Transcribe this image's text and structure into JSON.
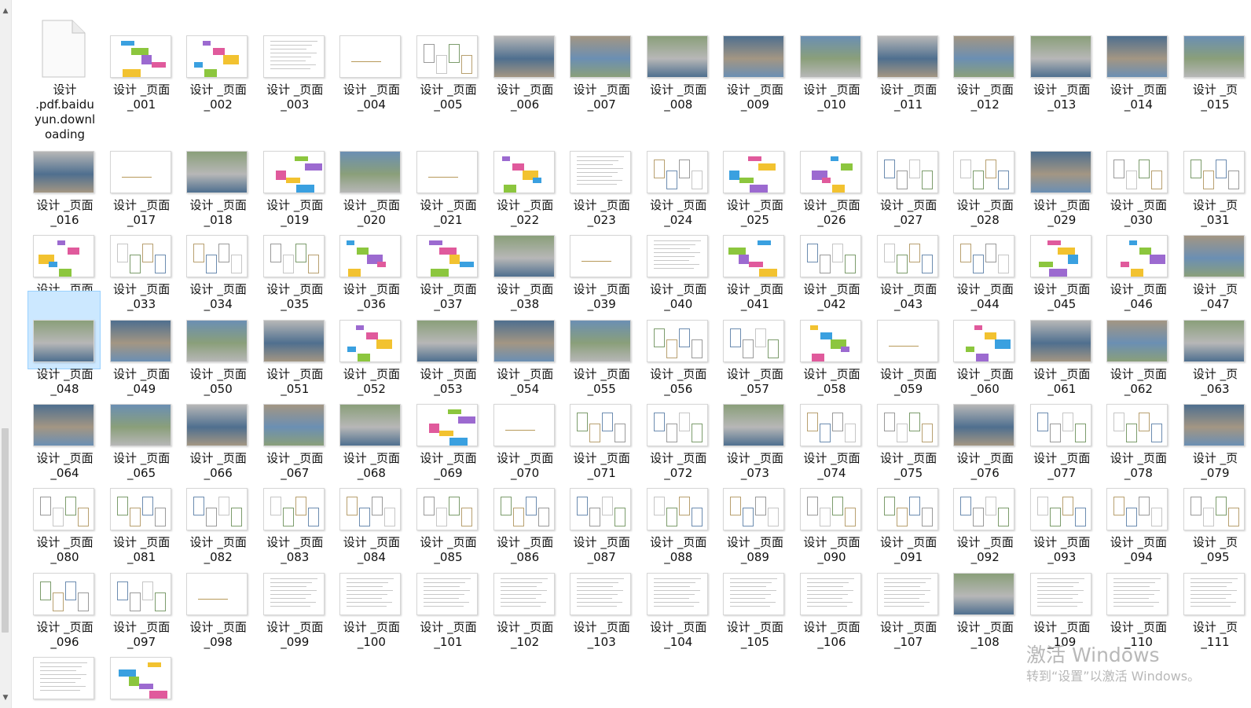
{
  "colors": {
    "selection_bg": "#cce8ff",
    "selection_border": "#99d1ff",
    "watermark": "#b8b8b8"
  },
  "files": [
    {
      "name": "设计\n.pdf.baidu\nyun.downl\noading",
      "icon": "blank-file-icon",
      "kind": "download"
    },
    {
      "name": "设计 _页面\n_001",
      "icon": "page-thumbnail",
      "kind": "color"
    },
    {
      "name": "设计 _页面\n_002",
      "icon": "page-thumbnail",
      "kind": "color"
    },
    {
      "name": "设计 _页面\n_003",
      "icon": "page-thumbnail",
      "kind": "text"
    },
    {
      "name": "设计 _页面\n_004",
      "icon": "page-thumbnail",
      "kind": "blank"
    },
    {
      "name": "设计 _页面\n_005",
      "icon": "page-thumbnail",
      "kind": "plan"
    },
    {
      "name": "设计 _页面\n_006",
      "icon": "page-thumbnail",
      "kind": "photo"
    },
    {
      "name": "设计 _页面\n_007",
      "icon": "page-thumbnail",
      "kind": "photo"
    },
    {
      "name": "设计 _页面\n_008",
      "icon": "page-thumbnail",
      "kind": "photo"
    },
    {
      "name": "设计 _页面\n_009",
      "icon": "page-thumbnail",
      "kind": "photo"
    },
    {
      "name": "设计 _页面\n_010",
      "icon": "page-thumbnail",
      "kind": "photo"
    },
    {
      "name": "设计 _页面\n_011",
      "icon": "page-thumbnail",
      "kind": "photo"
    },
    {
      "name": "设计 _页面\n_012",
      "icon": "page-thumbnail",
      "kind": "photo"
    },
    {
      "name": "设计 _页面\n_013",
      "icon": "page-thumbnail",
      "kind": "photo"
    },
    {
      "name": "设计 _页面\n_014",
      "icon": "page-thumbnail",
      "kind": "photo"
    },
    {
      "name": "设计 _页\n_015",
      "icon": "page-thumbnail",
      "kind": "photo"
    },
    {
      "name": "设计 _页面\n_016",
      "icon": "page-thumbnail",
      "kind": "photo"
    },
    {
      "name": "设计 _页面\n_017",
      "icon": "page-thumbnail",
      "kind": "blank"
    },
    {
      "name": "设计 _页面\n_018",
      "icon": "page-thumbnail",
      "kind": "photo"
    },
    {
      "name": "设计 _页面\n_019",
      "icon": "page-thumbnail",
      "kind": "color"
    },
    {
      "name": "设计 _页面\n_020",
      "icon": "page-thumbnail",
      "kind": "photo"
    },
    {
      "name": "设计 _页面\n_021",
      "icon": "page-thumbnail",
      "kind": "blank"
    },
    {
      "name": "设计 _页面\n_022",
      "icon": "page-thumbnail",
      "kind": "color"
    },
    {
      "name": "设计 _页面\n_023",
      "icon": "page-thumbnail",
      "kind": "text"
    },
    {
      "name": "设计 _页面\n_024",
      "icon": "page-thumbnail",
      "kind": "plan"
    },
    {
      "name": "设计 _页面\n_025",
      "icon": "page-thumbnail",
      "kind": "color"
    },
    {
      "name": "设计 _页面\n_026",
      "icon": "page-thumbnail",
      "kind": "color"
    },
    {
      "name": "设计 _页面\n_027",
      "icon": "page-thumbnail",
      "kind": "plan"
    },
    {
      "name": "设计 _页面\n_028",
      "icon": "page-thumbnail",
      "kind": "plan"
    },
    {
      "name": "设计 _页面\n_029",
      "icon": "page-thumbnail",
      "kind": "photo"
    },
    {
      "name": "设计 _页面\n_030",
      "icon": "page-thumbnail",
      "kind": "plan"
    },
    {
      "name": "设计 _页\n_031",
      "icon": "page-thumbnail",
      "kind": "plan"
    },
    {
      "name": "设计 _页面\n_032",
      "icon": "page-thumbnail",
      "kind": "color"
    },
    {
      "name": "设计 _页面\n_033",
      "icon": "page-thumbnail",
      "kind": "plan"
    },
    {
      "name": "设计 _页面\n_034",
      "icon": "page-thumbnail",
      "kind": "plan"
    },
    {
      "name": "设计 _页面\n_035",
      "icon": "page-thumbnail",
      "kind": "plan"
    },
    {
      "name": "设计 _页面\n_036",
      "icon": "page-thumbnail",
      "kind": "color"
    },
    {
      "name": "设计 _页面\n_037",
      "icon": "page-thumbnail",
      "kind": "color"
    },
    {
      "name": "设计 _页面\n_038",
      "icon": "page-thumbnail",
      "kind": "photo"
    },
    {
      "name": "设计 _页面\n_039",
      "icon": "page-thumbnail",
      "kind": "blank"
    },
    {
      "name": "设计 _页面\n_040",
      "icon": "page-thumbnail",
      "kind": "text"
    },
    {
      "name": "设计 _页面\n_041",
      "icon": "page-thumbnail",
      "kind": "color"
    },
    {
      "name": "设计 _页面\n_042",
      "icon": "page-thumbnail",
      "kind": "plan"
    },
    {
      "name": "设计 _页面\n_043",
      "icon": "page-thumbnail",
      "kind": "plan"
    },
    {
      "name": "设计 _页面\n_044",
      "icon": "page-thumbnail",
      "kind": "plan"
    },
    {
      "name": "设计 _页面\n_045",
      "icon": "page-thumbnail",
      "kind": "color"
    },
    {
      "name": "设计 _页面\n_046",
      "icon": "page-thumbnail",
      "kind": "color"
    },
    {
      "name": "设计 _页\n_047",
      "icon": "page-thumbnail",
      "kind": "photo"
    },
    {
      "name": "设计 _页面\n_048",
      "icon": "page-thumbnail",
      "kind": "photo",
      "selected": true
    },
    {
      "name": "设计 _页面\n_049",
      "icon": "page-thumbnail",
      "kind": "photo"
    },
    {
      "name": "设计 _页面\n_050",
      "icon": "page-thumbnail",
      "kind": "photo"
    },
    {
      "name": "设计 _页面\n_051",
      "icon": "page-thumbnail",
      "kind": "photo"
    },
    {
      "name": "设计 _页面\n_052",
      "icon": "page-thumbnail",
      "kind": "color"
    },
    {
      "name": "设计 _页面\n_053",
      "icon": "page-thumbnail",
      "kind": "photo"
    },
    {
      "name": "设计 _页面\n_054",
      "icon": "page-thumbnail",
      "kind": "photo"
    },
    {
      "name": "设计 _页面\n_055",
      "icon": "page-thumbnail",
      "kind": "photo"
    },
    {
      "name": "设计 _页面\n_056",
      "icon": "page-thumbnail",
      "kind": "plan"
    },
    {
      "name": "设计 _页面\n_057",
      "icon": "page-thumbnail",
      "kind": "plan"
    },
    {
      "name": "设计 _页面\n_058",
      "icon": "page-thumbnail",
      "kind": "color"
    },
    {
      "name": "设计 _页面\n_059",
      "icon": "page-thumbnail",
      "kind": "blank"
    },
    {
      "name": "设计 _页面\n_060",
      "icon": "page-thumbnail",
      "kind": "color"
    },
    {
      "name": "设计 _页面\n_061",
      "icon": "page-thumbnail",
      "kind": "photo"
    },
    {
      "name": "设计 _页面\n_062",
      "icon": "page-thumbnail",
      "kind": "photo"
    },
    {
      "name": "设计 _页\n_063",
      "icon": "page-thumbnail",
      "kind": "photo"
    },
    {
      "name": "设计 _页面\n_064",
      "icon": "page-thumbnail",
      "kind": "photo"
    },
    {
      "name": "设计 _页面\n_065",
      "icon": "page-thumbnail",
      "kind": "photo"
    },
    {
      "name": "设计 _页面\n_066",
      "icon": "page-thumbnail",
      "kind": "photo"
    },
    {
      "name": "设计 _页面\n_067",
      "icon": "page-thumbnail",
      "kind": "photo"
    },
    {
      "name": "设计 _页面\n_068",
      "icon": "page-thumbnail",
      "kind": "photo"
    },
    {
      "name": "设计 _页面\n_069",
      "icon": "page-thumbnail",
      "kind": "color"
    },
    {
      "name": "设计 _页面\n_070",
      "icon": "page-thumbnail",
      "kind": "blank"
    },
    {
      "name": "设计 _页面\n_071",
      "icon": "page-thumbnail",
      "kind": "plan"
    },
    {
      "name": "设计 _页面\n_072",
      "icon": "page-thumbnail",
      "kind": "plan"
    },
    {
      "name": "设计 _页面\n_073",
      "icon": "page-thumbnail",
      "kind": "photo"
    },
    {
      "name": "设计 _页面\n_074",
      "icon": "page-thumbnail",
      "kind": "plan"
    },
    {
      "name": "设计 _页面\n_075",
      "icon": "page-thumbnail",
      "kind": "plan"
    },
    {
      "name": "设计 _页面\n_076",
      "icon": "page-thumbnail",
      "kind": "photo"
    },
    {
      "name": "设计 _页面\n_077",
      "icon": "page-thumbnail",
      "kind": "plan"
    },
    {
      "name": "设计 _页面\n_078",
      "icon": "page-thumbnail",
      "kind": "plan"
    },
    {
      "name": "设计 _页\n_079",
      "icon": "page-thumbnail",
      "kind": "photo"
    },
    {
      "name": "设计 _页面\n_080",
      "icon": "page-thumbnail",
      "kind": "plan"
    },
    {
      "name": "设计 _页面\n_081",
      "icon": "page-thumbnail",
      "kind": "plan"
    },
    {
      "name": "设计 _页面\n_082",
      "icon": "page-thumbnail",
      "kind": "plan"
    },
    {
      "name": "设计 _页面\n_083",
      "icon": "page-thumbnail",
      "kind": "plan"
    },
    {
      "name": "设计 _页面\n_084",
      "icon": "page-thumbnail",
      "kind": "plan"
    },
    {
      "name": "设计 _页面\n_085",
      "icon": "page-thumbnail",
      "kind": "plan"
    },
    {
      "name": "设计 _页面\n_086",
      "icon": "page-thumbnail",
      "kind": "plan"
    },
    {
      "name": "设计 _页面\n_087",
      "icon": "page-thumbnail",
      "kind": "plan"
    },
    {
      "name": "设计 _页面\n_088",
      "icon": "page-thumbnail",
      "kind": "plan"
    },
    {
      "name": "设计 _页面\n_089",
      "icon": "page-thumbnail",
      "kind": "plan"
    },
    {
      "name": "设计 _页面\n_090",
      "icon": "page-thumbnail",
      "kind": "plan"
    },
    {
      "name": "设计 _页面\n_091",
      "icon": "page-thumbnail",
      "kind": "plan"
    },
    {
      "name": "设计 _页面\n_092",
      "icon": "page-thumbnail",
      "kind": "plan"
    },
    {
      "name": "设计 _页面\n_093",
      "icon": "page-thumbnail",
      "kind": "plan"
    },
    {
      "name": "设计 _页面\n_094",
      "icon": "page-thumbnail",
      "kind": "plan"
    },
    {
      "name": "设计 _页\n_095",
      "icon": "page-thumbnail",
      "kind": "plan"
    },
    {
      "name": "设计 _页面\n_096",
      "icon": "page-thumbnail",
      "kind": "plan"
    },
    {
      "name": "设计 _页面\n_097",
      "icon": "page-thumbnail",
      "kind": "plan"
    },
    {
      "name": "设计 _页面\n_098",
      "icon": "page-thumbnail",
      "kind": "blank"
    },
    {
      "name": "设计 _页面\n_099",
      "icon": "page-thumbnail",
      "kind": "text"
    },
    {
      "name": "设计 _页面\n_100",
      "icon": "page-thumbnail",
      "kind": "text"
    },
    {
      "name": "设计 _页面\n_101",
      "icon": "page-thumbnail",
      "kind": "text"
    },
    {
      "name": "设计 _页面\n_102",
      "icon": "page-thumbnail",
      "kind": "text"
    },
    {
      "name": "设计 _页面\n_103",
      "icon": "page-thumbnail",
      "kind": "text"
    },
    {
      "name": "设计 _页面\n_104",
      "icon": "page-thumbnail",
      "kind": "text"
    },
    {
      "name": "设计 _页面\n_105",
      "icon": "page-thumbnail",
      "kind": "text"
    },
    {
      "name": "设计 _页面\n_106",
      "icon": "page-thumbnail",
      "kind": "text"
    },
    {
      "name": "设计 _页面\n_107",
      "icon": "page-thumbnail",
      "kind": "text"
    },
    {
      "name": "设计 _页面\n_108",
      "icon": "page-thumbnail",
      "kind": "photo"
    },
    {
      "name": "设计 _页面\n_109",
      "icon": "page-thumbnail",
      "kind": "text"
    },
    {
      "name": "设计 _页面\n_110",
      "icon": "page-thumbnail",
      "kind": "text"
    },
    {
      "name": "设计 _页\n_111",
      "icon": "page-thumbnail",
      "kind": "text"
    },
    {
      "name": "",
      "icon": "page-thumbnail",
      "kind": "text"
    },
    {
      "name": "",
      "icon": "page-thumbnail",
      "kind": "color"
    }
  ],
  "watermark": {
    "title": "激活 Windows",
    "subtitle": "转到“设置”以激活 Windows。"
  }
}
